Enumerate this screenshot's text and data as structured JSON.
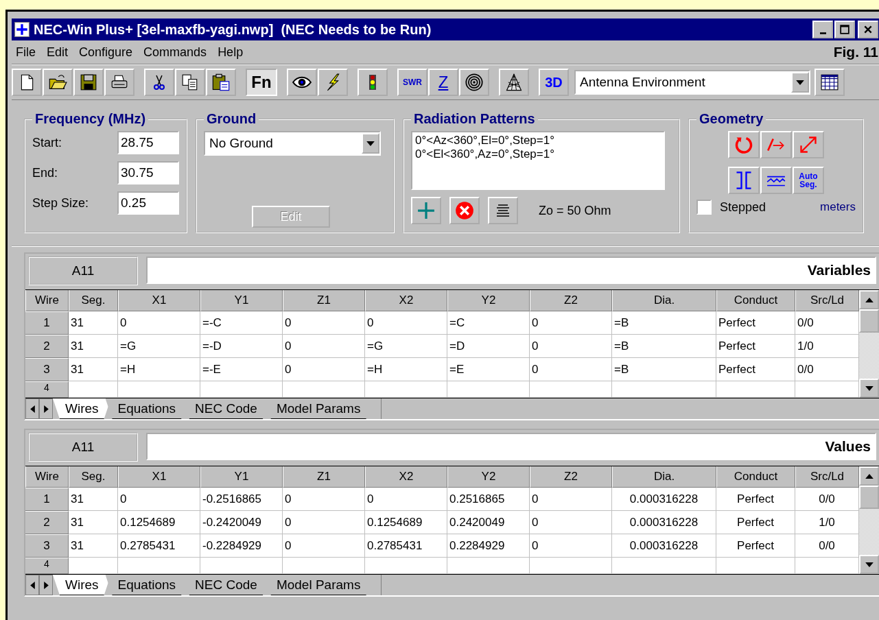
{
  "window": {
    "title": "NEC-Win Plus+ [3el-maxfb-yagi.nwp]  (NEC Needs to be Run)"
  },
  "menu": [
    "File",
    "Edit",
    "Configure",
    "Commands",
    "Help"
  ],
  "figure_label": "Fig. 11",
  "toolbar": {
    "fn_label": "Fn",
    "fn_pressed": true,
    "swr_label": "SWR",
    "z_label": "Z",
    "view3d_label": "3D",
    "environment": "Antenna Environment"
  },
  "frequency": {
    "title": "Frequency (MHz)",
    "fields": [
      {
        "label": "Start:",
        "value": "28.75"
      },
      {
        "label": "End:",
        "value": "30.75"
      },
      {
        "label": "Step Size:",
        "value": "0.25"
      }
    ]
  },
  "ground": {
    "title": "Ground",
    "value": "No Ground",
    "edit_button": "Edit",
    "edit_disabled": true
  },
  "radiation": {
    "title": "Radiation Patterns",
    "patterns": [
      "0°<Az<360°,El=0°,Step=1°",
      "0°<El<360°,Az=0°,Step=1°"
    ],
    "impedance": "Zo = 50 Ohm"
  },
  "geometry": {
    "title": "Geometry",
    "auto_seg": "Auto Seg.",
    "stepped_label": "Stepped",
    "stepped_checked": false,
    "units": "meters"
  },
  "sheets": [
    {
      "kind": "formulas",
      "cell_ref": "A11",
      "title": "Variables",
      "columns": [
        "Wire",
        "Seg.",
        "X1",
        "Y1",
        "Z1",
        "X2",
        "Y2",
        "Z2",
        "Dia.",
        "Conduct",
        "Src/Ld"
      ],
      "rows": [
        {
          "cells": [
            "1",
            "31",
            "0",
            "=-C",
            "0",
            "0",
            "=C",
            "0",
            "=B",
            "Perfect",
            "0/0"
          ]
        },
        {
          "cells": [
            "2",
            "31",
            "=G",
            "=-D",
            "0",
            "=G",
            "=D",
            "0",
            "=B",
            "Perfect",
            "1/0"
          ]
        },
        {
          "cells": [
            "3",
            "31",
            "=H",
            "=-E",
            "0",
            "=H",
            "=E",
            "0",
            "=B",
            "Perfect",
            "0/0"
          ]
        }
      ],
      "partial_row": "4",
      "tabs": [
        {
          "label": "Wires",
          "selected": true
        },
        {
          "label": "Equations",
          "selected": false
        },
        {
          "label": "NEC Code",
          "selected": false
        },
        {
          "label": "Model Params",
          "selected": false
        }
      ]
    },
    {
      "kind": "values",
      "cell_ref": "A11",
      "title": "Values",
      "columns": [
        "Wire",
        "Seg.",
        "X1",
        "Y1",
        "Z1",
        "X2",
        "Y2",
        "Z2",
        "Dia.",
        "Conduct",
        "Src/Ld"
      ],
      "rows": [
        {
          "cells": [
            "1",
            "31",
            "0",
            "-0.2516865",
            "0",
            "0",
            "0.2516865",
            "0",
            "0.000316228",
            "Perfect",
            "0/0"
          ]
        },
        {
          "cells": [
            "2",
            "31",
            "0.1254689",
            "-0.2420049",
            "0",
            "0.1254689",
            "0.2420049",
            "0",
            "0.000316228",
            "Perfect",
            "1/0"
          ]
        },
        {
          "cells": [
            "3",
            "31",
            "0.2785431",
            "-0.2284929",
            "0",
            "0.2785431",
            "0.2284929",
            "0",
            "0.000316228",
            "Perfect",
            "0/0"
          ]
        }
      ],
      "partial_row": "4",
      "tabs": [
        {
          "label": "Wires",
          "selected": true
        },
        {
          "label": "Equations",
          "selected": false
        },
        {
          "label": "NEC Code",
          "selected": false
        },
        {
          "label": "Model Params",
          "selected": false
        }
      ]
    }
  ]
}
